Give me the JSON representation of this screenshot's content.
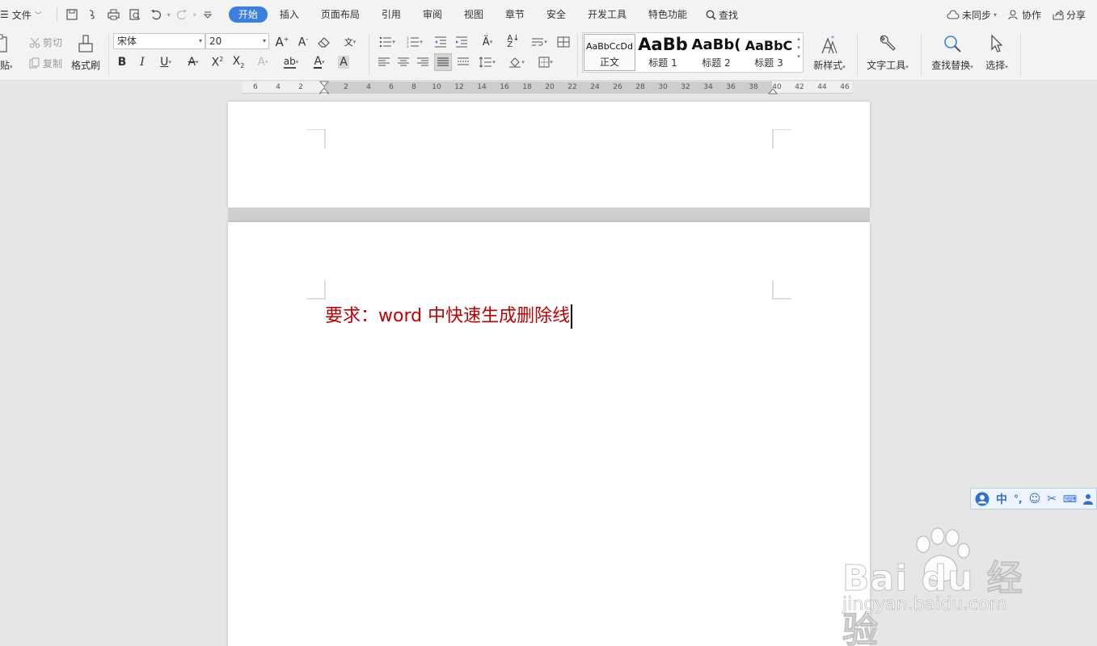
{
  "menubar": {
    "file_label": "文件",
    "tabs": [
      {
        "label": "开始",
        "active": true
      },
      {
        "label": "插入"
      },
      {
        "label": "页面布局"
      },
      {
        "label": "引用"
      },
      {
        "label": "审阅"
      },
      {
        "label": "视图"
      },
      {
        "label": "章节"
      },
      {
        "label": "安全"
      },
      {
        "label": "开发工具"
      },
      {
        "label": "特色功能"
      }
    ],
    "search_label": "查找",
    "sync_label": "未同步",
    "collab_label": "协作",
    "share_label": "分享"
  },
  "ribbon": {
    "paste_label": "贴",
    "cut_label": "剪切",
    "copy_label": "复制",
    "format_painter_label": "格式刷",
    "font_name": "宋体",
    "font_size": "20",
    "styles": [
      {
        "preview": "AaBbCcDd",
        "name": "正文"
      },
      {
        "preview": "AaBb",
        "name": "标题 1"
      },
      {
        "preview": "AaBb(",
        "name": "标题 2"
      },
      {
        "preview": "AaBbC",
        "name": "标题 3"
      }
    ],
    "new_style_label": "新样式",
    "text_tools_label": "文字工具",
    "find_replace_label": "查找替换",
    "select_label": "选择"
  },
  "ruler": {
    "ticks": [
      "6",
      "4",
      "2",
      "2",
      "4",
      "6",
      "8",
      "10",
      "12",
      "14",
      "16",
      "18",
      "20",
      "22",
      "24",
      "26",
      "28",
      "30",
      "32",
      "34",
      "36",
      "38",
      "40",
      "42",
      "44",
      "46"
    ]
  },
  "document": {
    "text": "要求：word 中快速生成删除线"
  },
  "ime": {
    "lang_label": "中"
  },
  "watermark": {
    "brand": "Bai du 经验",
    "url": "jingyan.baidu.com"
  },
  "colors": {
    "accent": "#3b7fe0",
    "doc_text": "#c00000"
  }
}
